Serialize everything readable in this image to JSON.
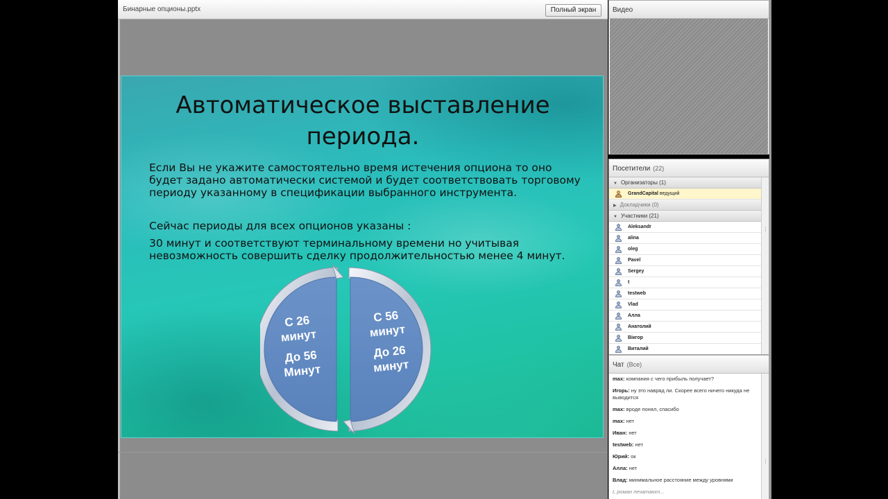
{
  "presentation": {
    "file_name": "Бинарные опционы.pptx",
    "fullscreen_label": "Полный экран"
  },
  "slide": {
    "title_line1": "Автоматическое выставление",
    "title_line2": "периода.",
    "para1_line1": "Если Вы не укажите самостоятельно время истечения опциона то оно",
    "para1_line2": "будет задано автоматически системой и будет соответствовать торговому",
    "para1_line3": "периоду указанному в спецификации выбранного инструмента.",
    "para2_line1": "Сейчас периоды для всех опционов указаны :",
    "para3_line1": "30 минут и соответствуют терминальному времени но учитывая",
    "para3_line2": "невозможность совершить сделку продолжительностью менее 4 минут.",
    "left_segment": {
      "l1": "С 26",
      "l2": "минут",
      "l3": "До 56",
      "l4": "Минут"
    },
    "right_segment": {
      "l1": "С 56",
      "l2": "минут",
      "l3": "До 26",
      "l4": "минут"
    }
  },
  "video": {
    "title": "Видео"
  },
  "attendees": {
    "title": "Посетители",
    "count": "(22)",
    "groups": [
      {
        "label": "Организаторы (1)"
      },
      {
        "label": "Докладчики (0)"
      },
      {
        "label": "Участники (21)"
      }
    ],
    "host": {
      "name": "GrandCapital",
      "role": "ведущий"
    },
    "participants": [
      "Aleksandr",
      "alina",
      "oleg",
      "Pavel",
      "Sergey",
      "t",
      "testweb",
      "Vlad",
      "Алла",
      "Анатолий",
      "Вікгор",
      "Виталий"
    ]
  },
  "chat": {
    "title": "Чат",
    "scope": "(Все)",
    "messages": [
      {
        "who": "max:",
        "text": "компания с чего прибыль получает?"
      },
      {
        "who": "Игорь:",
        "text": "ну это навряд ли. Скорее всего ничего никуда не выводится"
      },
      {
        "who": "max:",
        "text": "вроде понял, спасибо"
      },
      {
        "who": "max:",
        "text": "нет"
      },
      {
        "who": "Иван:",
        "text": "нет"
      },
      {
        "who": "testweb:",
        "text": "нет"
      },
      {
        "who": "Юрий:",
        "text": "ок"
      },
      {
        "who": "Алла:",
        "text": "нет"
      },
      {
        "who": "Влад:",
        "text": "минимальное расстояние между уровнями"
      }
    ],
    "typing": "t, роман печатают..."
  }
}
